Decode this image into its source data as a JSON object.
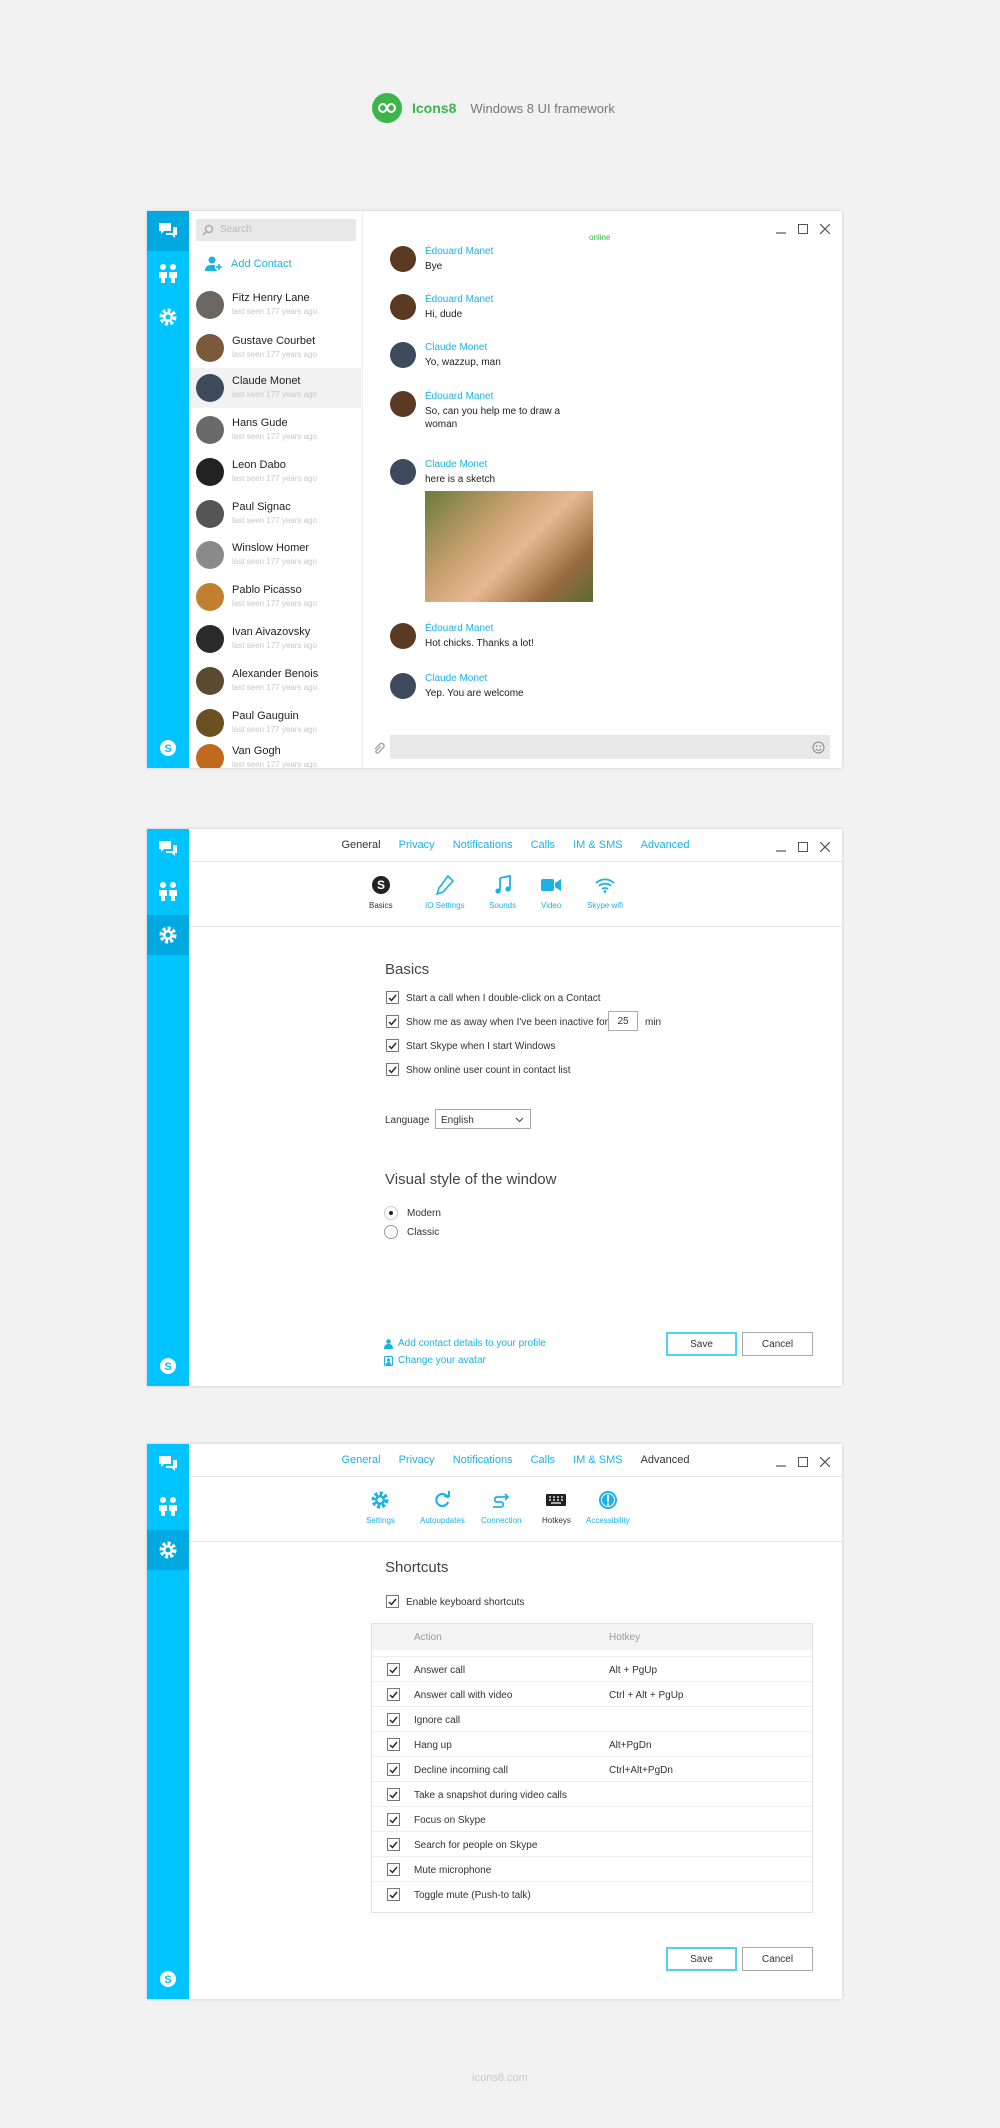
{
  "header": {
    "brand": "Icons8",
    "tagline": "Windows 8 UI framework"
  },
  "footer": {
    "text": "icons8.com"
  },
  "colors": {
    "accent": "#00c4ff",
    "link": "#1cb2e6",
    "brand": "#3cb54a",
    "status": "#3cb54a"
  },
  "chat": {
    "search_placeholder": "Search",
    "add_contact": "Add Contact",
    "status": "online",
    "contacts": [
      {
        "name": "Fitz Henry Lane",
        "last_seen": "last seen 177 years ago"
      },
      {
        "name": "Gustave Courbet",
        "last_seen": "last seen 177 years ago"
      },
      {
        "name": "Claude Monet",
        "last_seen": "last seen 177 years ago"
      },
      {
        "name": "Hans Gude",
        "last_seen": "last seen 177 years ago"
      },
      {
        "name": "Leon Dabo",
        "last_seen": "last seen 177 years ago"
      },
      {
        "name": "Paul Signac",
        "last_seen": "last seen 177 years ago"
      },
      {
        "name": "Winslow Homer",
        "last_seen": "last seen 177 years ago"
      },
      {
        "name": "Pablo Picasso",
        "last_seen": "last seen 177 years ago"
      },
      {
        "name": "Ivan Aivazovsky",
        "last_seen": "last seen 177 years ago"
      },
      {
        "name": "Alexander Benois",
        "last_seen": "last seen 177 years ago"
      },
      {
        "name": "Paul Gauguin",
        "last_seen": "last seen 177 years ago"
      },
      {
        "name": "Van Gogh",
        "last_seen": "last seen 177 years ago"
      }
    ],
    "messages": [
      {
        "sender": "Édouard Manet",
        "text": "Bye"
      },
      {
        "sender": "Édouard Manet",
        "text": "Hi, dude"
      },
      {
        "sender": "Claude Monet",
        "text": "Yo, wazzup, man"
      },
      {
        "sender": "Édouard Manet",
        "text": "So, can you help me to draw a woman"
      },
      {
        "sender": "Claude Monet",
        "text": "here is a sketch"
      },
      {
        "sender": "Édouard Manet",
        "text": "Hot chicks. Thanks a lot!"
      },
      {
        "sender": "Claude Monet",
        "text": "Yep. You are welcome"
      }
    ]
  },
  "tabs": [
    "General",
    "Privacy",
    "Notifications",
    "Calls",
    "IM & SMS",
    "Advanced"
  ],
  "general": {
    "subtabs": [
      "Basics",
      "IO Settings",
      "Sounds",
      "Video",
      "Skype wifi"
    ],
    "section_title": "Basics",
    "options": [
      "Start a call when I double-click on a Contact",
      "Show me as away when I've been inactive for",
      "Start Skype when I start Windows",
      "Show online user count in contact list"
    ],
    "inactive_minutes": "25",
    "minutes_unit": "min",
    "language_label": "Language",
    "language_value": "English",
    "visual_title": "Visual style of the window",
    "styles": [
      "Modern",
      "Classic"
    ],
    "links": [
      "Add contact details to your profile",
      "Change your avatar"
    ],
    "save": "Save",
    "cancel": "Cancel"
  },
  "advanced": {
    "subtabs": [
      "Settings",
      "Autoupdates",
      "Connection",
      "Hotkeys",
      "Accessibility"
    ],
    "section_title": "Shortcuts",
    "enable_label": "Enable keyboard shortcuts",
    "col_action": "Action",
    "col_hotkey": "Hotkey",
    "rows": [
      {
        "action": "Answer call",
        "hotkey": "Alt + PgUp"
      },
      {
        "action": "Answer call with video",
        "hotkey": "Ctrl + Alt + PgUp"
      },
      {
        "action": "Ignore call",
        "hotkey": ""
      },
      {
        "action": "Hang up",
        "hotkey": "Alt+PgDn"
      },
      {
        "action": "Decline incoming call",
        "hotkey": "Ctrl+Alt+PgDn"
      },
      {
        "action": "Take a snapshot during video calls",
        "hotkey": ""
      },
      {
        "action": "Focus on Skype",
        "hotkey": ""
      },
      {
        "action": "Search for people on Skype",
        "hotkey": ""
      },
      {
        "action": "Mute microphone",
        "hotkey": ""
      },
      {
        "action": "Toggle mute (Push-to talk)",
        "hotkey": ""
      }
    ],
    "save": "Save",
    "cancel": "Cancel"
  }
}
